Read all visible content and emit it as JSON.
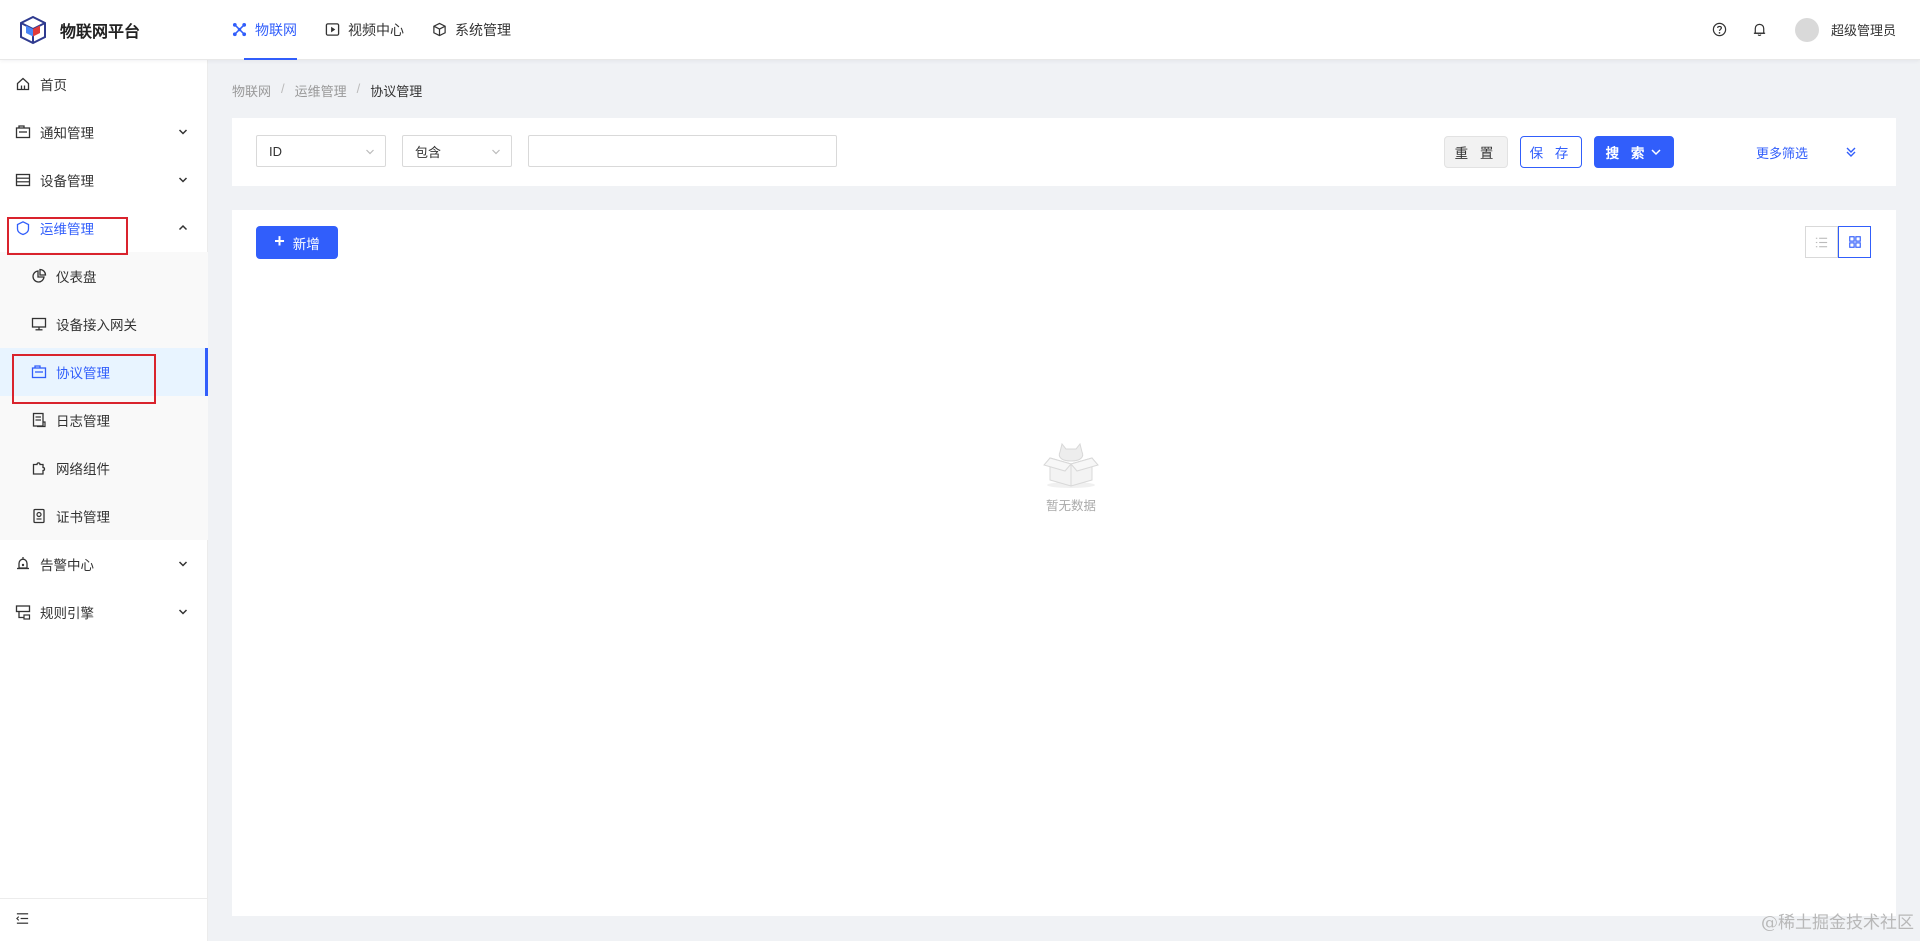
{
  "app": {
    "title": "物联网平台"
  },
  "topnav": {
    "tabs": [
      {
        "label": "物联网",
        "icon": "iot-icon",
        "active": true
      },
      {
        "label": "视频中心",
        "icon": "video-play-icon",
        "active": false
      },
      {
        "label": "系统管理",
        "icon": "system-cube-icon",
        "active": false
      }
    ]
  },
  "header": {
    "username": "超级管理员"
  },
  "sidebar": {
    "items": [
      {
        "label": "首页",
        "icon": "home-icon"
      },
      {
        "label": "通知管理",
        "icon": "notice-icon",
        "expandable": true
      },
      {
        "label": "设备管理",
        "icon": "device-icon",
        "expandable": true
      },
      {
        "label": "运维管理",
        "icon": "shield-icon",
        "expandable": true,
        "open": true
      },
      {
        "label": "仪表盘",
        "icon": "pie-chart-icon",
        "sub": true
      },
      {
        "label": "设备接入网关",
        "icon": "monitor-icon",
        "sub": true
      },
      {
        "label": "协议管理",
        "icon": "protocol-icon",
        "sub": true,
        "selected": true
      },
      {
        "label": "日志管理",
        "icon": "log-file-icon",
        "sub": true
      },
      {
        "label": "网络组件",
        "icon": "puzzle-icon",
        "sub": true
      },
      {
        "label": "证书管理",
        "icon": "certificate-icon",
        "sub": true
      },
      {
        "label": "告警中心",
        "icon": "alarm-icon",
        "expandable": true
      },
      {
        "label": "规则引擎",
        "icon": "rule-icon",
        "expandable": true
      }
    ]
  },
  "breadcrumb": {
    "items": [
      "物联网",
      "运维管理",
      "协议管理"
    ]
  },
  "filter": {
    "field_value": "ID",
    "operator_value": "包含",
    "search_value": "",
    "reset_label": "重 置",
    "save_label": "保 存",
    "search_label": "搜 索",
    "more_label": "更多筛选"
  },
  "content": {
    "add_label": "新增",
    "empty_text": "暂无数据"
  },
  "watermark": "@稀土掘金技术社区",
  "colors": {
    "primary": "#315efb",
    "highlight_box": "#d9232d",
    "selected_bg": "#e8f4ff"
  }
}
